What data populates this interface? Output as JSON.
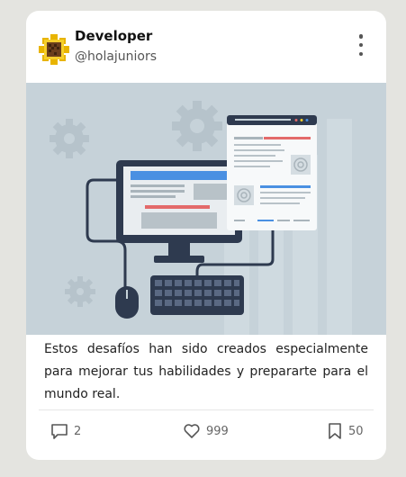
{
  "post": {
    "author_name": "Developer",
    "author_handle": "@holajuniors",
    "description": "Estos desafíos han sido creados especialmente para mejorar tus habilidades y prepararte para el mundo real.",
    "comments_count": "2",
    "likes_count": "999",
    "bookmarks_count": "50"
  },
  "icons": {
    "avatar": "sunflower-pixel-icon",
    "more": "more-vertical-icon",
    "comment": "comment-icon",
    "like": "heart-icon",
    "bookmark": "bookmark-icon"
  },
  "colors": {
    "background": "#e4e4e0",
    "card": "#ffffff",
    "illustration_bg": "#c6d2d9",
    "monitor": "#2e3a4f",
    "accent_blue": "#4a90e2",
    "accent_red": "#e36a6a"
  }
}
